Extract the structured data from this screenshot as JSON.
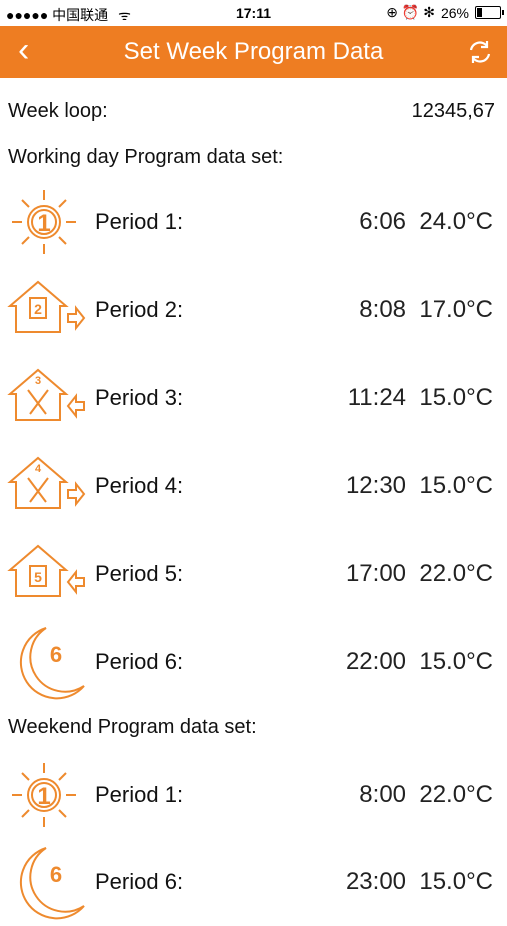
{
  "status": {
    "carrier": "●●●●● 中国联通",
    "wifi_icon": "wifi-icon",
    "time": "17:11",
    "icons": "⊕ ⏰ ✻",
    "battery_percent": "26%",
    "battery_level": 0.26
  },
  "nav": {
    "back_icon": "chevron-left-icon",
    "back_glyph": "‹",
    "title": "Set Week Program Data",
    "refresh_icon": "refresh-icon"
  },
  "week_loop": {
    "label": "Week loop:",
    "value": "12345,67"
  },
  "working": {
    "heading": "Working day Program data set:",
    "periods": [
      {
        "icon": "sun-icon",
        "number": "1",
        "label": "Period 1:",
        "time": "6:06",
        "temp": "24.0°C"
      },
      {
        "icon": "house-leave-icon",
        "number": "2",
        "label": "Period 2:",
        "time": "8:08",
        "temp": "17.0°C"
      },
      {
        "icon": "house-meal-return-icon",
        "number": "3",
        "label": "Period 3:",
        "time": "11:24",
        "temp": "15.0°C"
      },
      {
        "icon": "house-meal-leave-icon",
        "number": "4",
        "label": "Period 4:",
        "time": "12:30",
        "temp": "15.0°C"
      },
      {
        "icon": "house-return-icon",
        "number": "5",
        "label": "Period 5:",
        "time": "17:00",
        "temp": "22.0°C"
      },
      {
        "icon": "moon-icon",
        "number": "6",
        "label": "Period 6:",
        "time": "22:00",
        "temp": "15.0°C"
      }
    ]
  },
  "weekend": {
    "heading": "Weekend Program data set:",
    "periods": [
      {
        "icon": "sun-icon",
        "number": "1",
        "label": "Period 1:",
        "time": "8:00",
        "temp": "22.0°C"
      },
      {
        "icon": "moon-icon",
        "number": "6",
        "label": "Period 6:",
        "time": "23:00",
        "temp": "15.0°C"
      }
    ]
  },
  "colors": {
    "accent": "#ee7d22",
    "icon": "#ee8a2e"
  }
}
